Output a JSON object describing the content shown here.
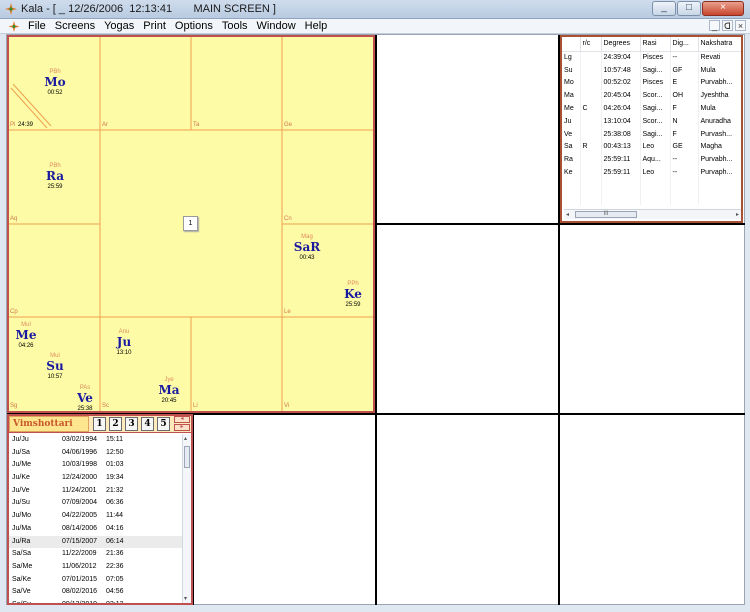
{
  "window": {
    "title": "Kala - [ _ 12/26/2006  12:13:41       MAIN SCREEN ]",
    "minimize": "_",
    "maximize": "□",
    "close": "×"
  },
  "menu": {
    "items": [
      "File",
      "Screens",
      "Yogas",
      "Print",
      "Options",
      "Tools",
      "Window",
      "Help"
    ],
    "mdi": [
      "_",
      "ᗡ",
      "×"
    ]
  },
  "chart": {
    "center_number": "1",
    "asc_degree": "24:39",
    "signs": {
      "pi": "Pi",
      "ar": "Ar",
      "ta": "Ta",
      "ge": "Ge",
      "aq": "Aq",
      "cn": "Cn",
      "cp": "Cp",
      "le": "Le",
      "sg": "Sg",
      "sc": "Sc",
      "li": "Li",
      "vi": "Vi"
    },
    "planets": [
      {
        "key": "mo",
        "nak": "PBh",
        "abbr": "Mo",
        "deg": "00:52"
      },
      {
        "key": "ra",
        "nak": "PBh",
        "abbr": "Ra",
        "deg": "25:59"
      },
      {
        "key": "sa",
        "nak": "Mag",
        "abbr": "SaR",
        "deg": "00:43"
      },
      {
        "key": "ke",
        "nak": "PPh",
        "abbr": "Ke",
        "deg": "25:59"
      },
      {
        "key": "me",
        "nak": "Mul",
        "abbr": "Me",
        "deg": "04:26"
      },
      {
        "key": "su",
        "nak": "Mul",
        "abbr": "Su",
        "deg": "10:57"
      },
      {
        "key": "ve",
        "nak": "PAs",
        "abbr": "Ve",
        "deg": "25:38"
      },
      {
        "key": "ju",
        "nak": "Anu",
        "abbr": "Ju",
        "deg": "13:10"
      },
      {
        "key": "ma",
        "nak": "Jye",
        "abbr": "Ma",
        "deg": "20:45"
      }
    ]
  },
  "planet_table": {
    "headers": [
      "",
      "r/c",
      "Degrees",
      "Rasi",
      "Dig...",
      "Nakshatra"
    ],
    "rows": [
      [
        "Lg",
        "",
        "24:39:04",
        "Pisces",
        "--",
        "Revati"
      ],
      [
        "Su",
        "",
        "10:57:48",
        "Sagi...",
        "GF",
        "Mula"
      ],
      [
        "Mo",
        "",
        "00:52:02",
        "Pisces",
        "E",
        "Purvabh..."
      ],
      [
        "Ma",
        "",
        "20:45:04",
        "Scor...",
        "OH",
        "Jyeshtha"
      ],
      [
        "Me",
        "C",
        "04:26:04",
        "Sagi...",
        "F",
        "Mula"
      ],
      [
        "Ju",
        "",
        "13:10:04",
        "Scor...",
        "N",
        "Anuradha"
      ],
      [
        "Ve",
        "",
        "25:38:08",
        "Sagi...",
        "F",
        "Purvash..."
      ],
      [
        "Sa",
        "R",
        "00:43:13",
        "Leo",
        "GE",
        "Magha"
      ],
      [
        "Ra",
        "",
        "25:59:11",
        "Aqu...",
        "--",
        "Purvabh..."
      ],
      [
        "Ke",
        "",
        "25:59:11",
        "Leo",
        "--",
        "Purvaph..."
      ]
    ],
    "scroll_left": "◂",
    "scroll_thumb": "III",
    "scroll_right": "▸"
  },
  "dasha": {
    "title": "Vimshottari",
    "levels": [
      "1",
      "2",
      "3",
      "4",
      "5"
    ],
    "nav_up": "◂",
    "nav_down": "▸",
    "scroll_up": "▴",
    "scroll_down": "▾",
    "rows": [
      {
        "period": "Ju/Ju",
        "date": "03/02/1994",
        "time": "15:11",
        "selected": false
      },
      {
        "period": "Ju/Sa",
        "date": "04/06/1996",
        "time": "12:50",
        "selected": false
      },
      {
        "period": "Ju/Me",
        "date": "10/03/1998",
        "time": "01:03",
        "selected": false
      },
      {
        "period": "Ju/Ke",
        "date": "12/24/2000",
        "time": "19:34",
        "selected": false
      },
      {
        "period": "Ju/Ve",
        "date": "11/24/2001",
        "time": "21:32",
        "selected": false
      },
      {
        "period": "Ju/Su",
        "date": "07/09/2004",
        "time": "06:36",
        "selected": false
      },
      {
        "period": "Ju/Mo",
        "date": "04/22/2005",
        "time": "11:44",
        "selected": false
      },
      {
        "period": "Ju/Ma",
        "date": "08/14/2006",
        "time": "04:16",
        "selected": false
      },
      {
        "period": "Ju/Ra",
        "date": "07/15/2007",
        "time": "06:14",
        "selected": true
      },
      {
        "period": "Sa/Sa",
        "date": "11/22/2009",
        "time": "21:36",
        "selected": false
      },
      {
        "period": "Sa/Me",
        "date": "11/06/2012",
        "time": "22:36",
        "selected": false
      },
      {
        "period": "Sa/Ke",
        "date": "07/01/2015",
        "time": "07:05",
        "selected": false
      },
      {
        "period": "Sa/Ve",
        "date": "08/02/2016",
        "time": "04:56",
        "selected": false
      },
      {
        "period": "Sa/Su",
        "date": "09/13/2019",
        "time": "02:12",
        "selected": false
      }
    ]
  }
}
